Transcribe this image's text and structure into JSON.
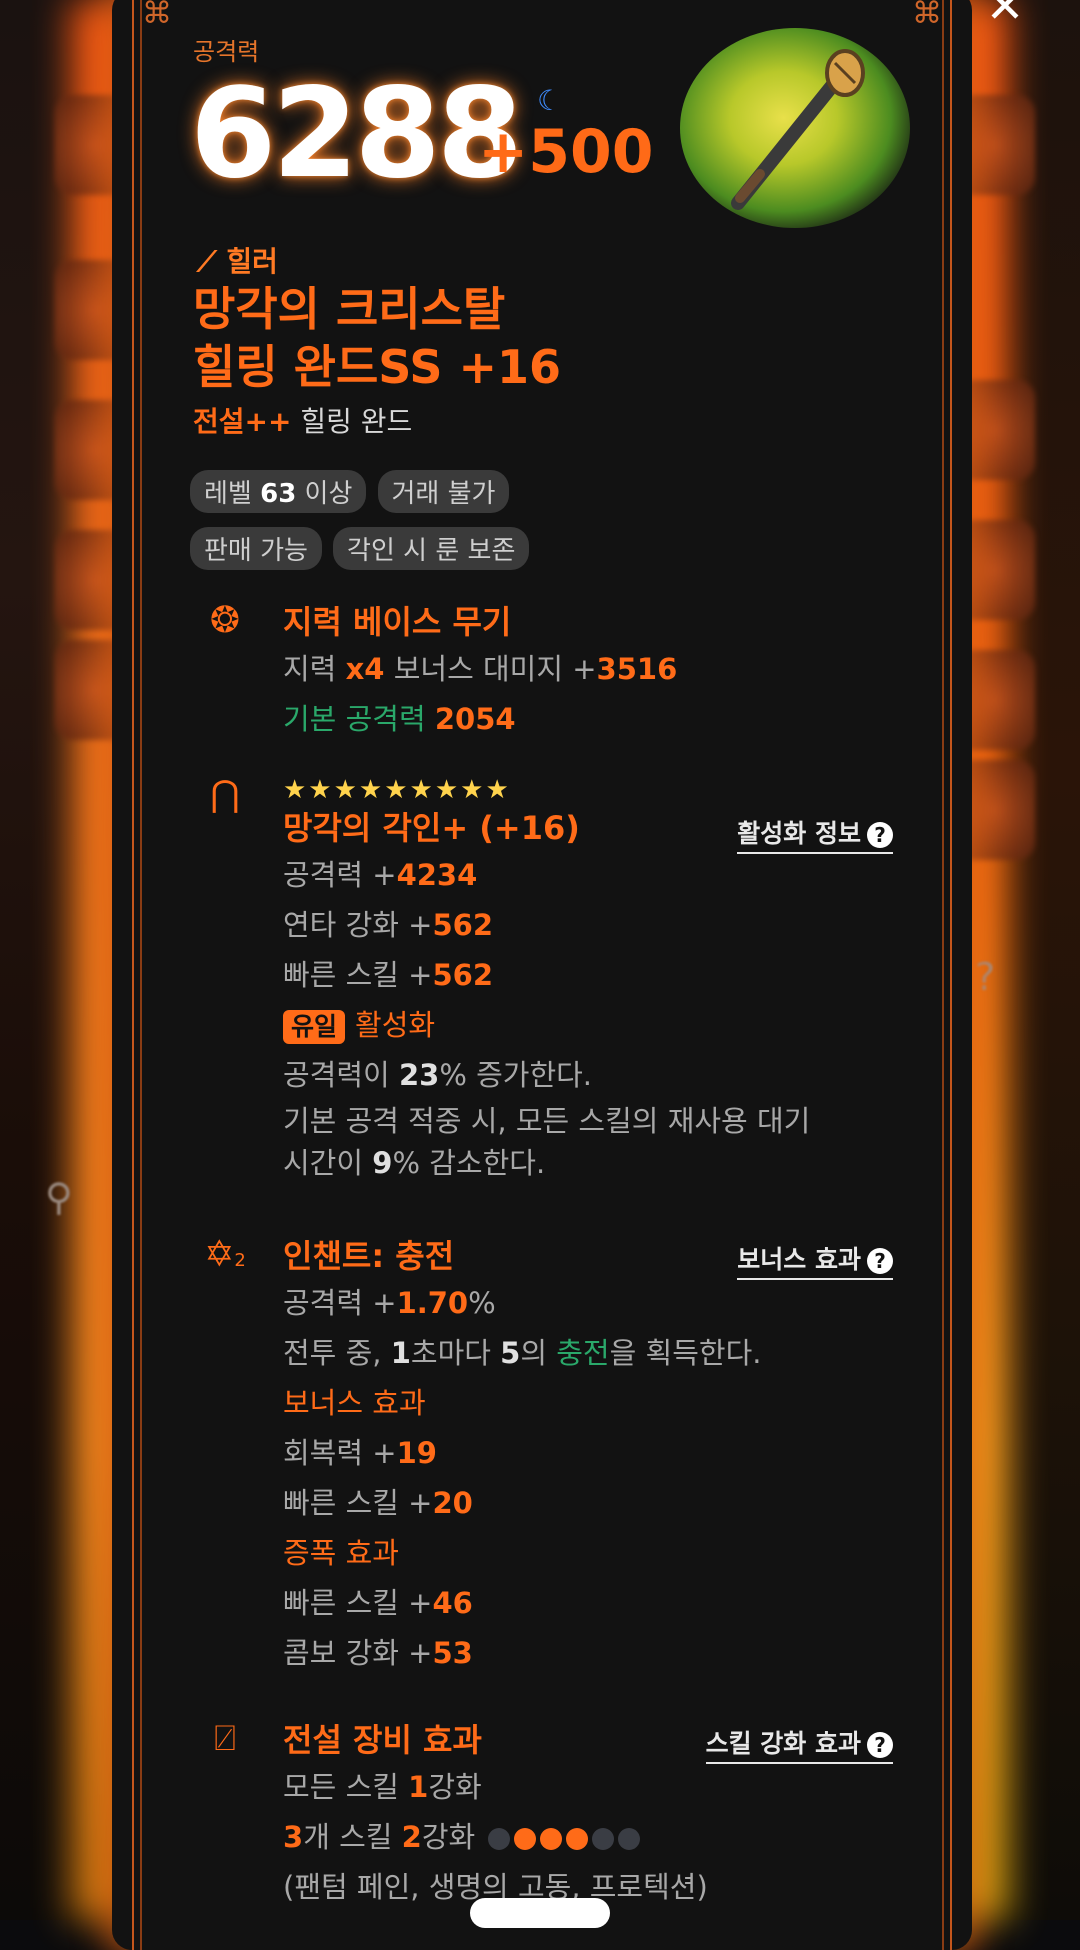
{
  "header": {
    "attack_label": "공격력",
    "attack_value": "6288",
    "attack_bonus": "+500",
    "moon_icon": "moon-icon",
    "close_label": "✕"
  },
  "item": {
    "class_icon": "wand-icon",
    "class_label": "힐러",
    "name_line1": "망각의 크리스탈",
    "name_line2": "힐링 완드SS +16",
    "grade": "전설++",
    "type": "힐링 완드"
  },
  "tags": [
    {
      "pre": "레벨 ",
      "bold": "63",
      "post": " 이상"
    },
    {
      "pre": "거래 불가",
      "bold": "",
      "post": ""
    },
    {
      "pre": "판매 가능",
      "bold": "",
      "post": ""
    },
    {
      "pre": "각인 시 룬 보존",
      "bold": "",
      "post": ""
    }
  ],
  "base": {
    "icon": "brain-icon",
    "title": "지력 베이스 무기",
    "l1_a": "지력 ",
    "l1_b": "x4",
    "l1_c": " 보너스 대미지 +",
    "l1_d": "3516",
    "l2_a": "기본 공격력 ",
    "l2_b": "2054"
  },
  "engrave": {
    "icon": "rune-icon",
    "stars": "★★★★★★★★★",
    "title": "망각의 각인+ (+16)",
    "link": "활성화 정보",
    "stats": [
      {
        "name": "공격력 +",
        "value": "4234"
      },
      {
        "name": "연타 강화 +",
        "value": "562"
      },
      {
        "name": "빠른 스킬 +",
        "value": "562"
      }
    ],
    "unique_badge": "유일",
    "unique_text": "활성화",
    "desc1_a": "공격력이 ",
    "desc1_b": "23",
    "desc1_c": "% 증가한다.",
    "desc2": "기본 공격 적중 시, 모든 스킬의 재사용 대기",
    "desc3_a": "시간이 ",
    "desc3_b": "9",
    "desc3_c": "% 감소한다."
  },
  "enchant": {
    "icon": "enchant-star-icon",
    "title": "인챈트: 충전",
    "link": "보너스 효과",
    "l1_a": "공격력 +",
    "l1_b": "1.70",
    "l1_c": "%",
    "l2_a": "전투 중, ",
    "l2_b": "1",
    "l2_c": "초마다 ",
    "l2_d": "5",
    "l2_e": "의 ",
    "l2_f": "충전",
    "l2_g": "을 획득한다.",
    "bonus_title": "보너스 효과",
    "bonus": [
      {
        "name": "회복력 +",
        "value": "19"
      },
      {
        "name": "빠른 스킬 +",
        "value": "20"
      }
    ],
    "amp_title": "증폭 효과",
    "amp": [
      {
        "name": "빠른 스킬 +",
        "value": "46"
      },
      {
        "name": "콤보 강화 +",
        "value": "53"
      }
    ]
  },
  "legend": {
    "icon": "legend-icon",
    "title": "전설 장비 효과",
    "link": "스킬 강화 효과",
    "l1_a": "모든 스킬 ",
    "l1_b": "1",
    "l1_c": "강화",
    "l2_a": "3",
    "l2_b": "개 스킬 ",
    "l2_c": "2",
    "l2_d": "강화",
    "dots": [
      0,
      1,
      1,
      1,
      0,
      0
    ],
    "l3": "(팬텀 페인, 생명의 고동, 프로텍션)"
  },
  "colors": {
    "accent": "#ff6b18",
    "green": "#2aa86a",
    "gold": "#ffd34d"
  }
}
